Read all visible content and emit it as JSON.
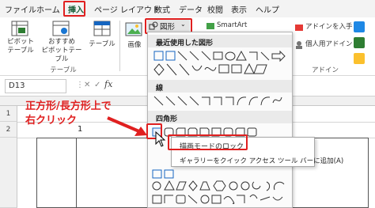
{
  "menu": {
    "items": [
      "ファイル",
      "ホーム",
      "挿入",
      "ページ レイアウト",
      "数式",
      "データ",
      "校閲",
      "表示",
      "ヘルプ"
    ],
    "active_index": 2
  },
  "ribbon": {
    "pivot_table": "ピボット\nテーブル",
    "recommended_pivot": "おすすめ\nピボットテーブル",
    "table": "テーブル",
    "group_table": "テーブル",
    "image": "画像",
    "shapes_button": "図形",
    "smartart": "SmartArt",
    "addin_get": "アドインを入手",
    "personal_addin": "個人用アドイン",
    "group_addin": "アドイン"
  },
  "formula_bar": {
    "name_box": "D13",
    "cancel_icon": "✕",
    "enter_icon": "✓",
    "fx": "fx"
  },
  "grid": {
    "row_numbers": [
      "1",
      "2"
    ],
    "cell_value": "1"
  },
  "shapes_panel": {
    "recent_title": "最近使用した図形",
    "lines_title": "線",
    "rectangles_title": "四角形"
  },
  "context_menu": {
    "lock_mode": "描画モードのロック",
    "add_to_qat": "ギャラリーをクイック アクセス ツール バーに追加(A)"
  },
  "annotation": {
    "line1": "正方形/長方形上で",
    "line2": "右クリック"
  },
  "colors": {
    "highlight_red": "#e02020",
    "excel_green": "#185c37"
  }
}
